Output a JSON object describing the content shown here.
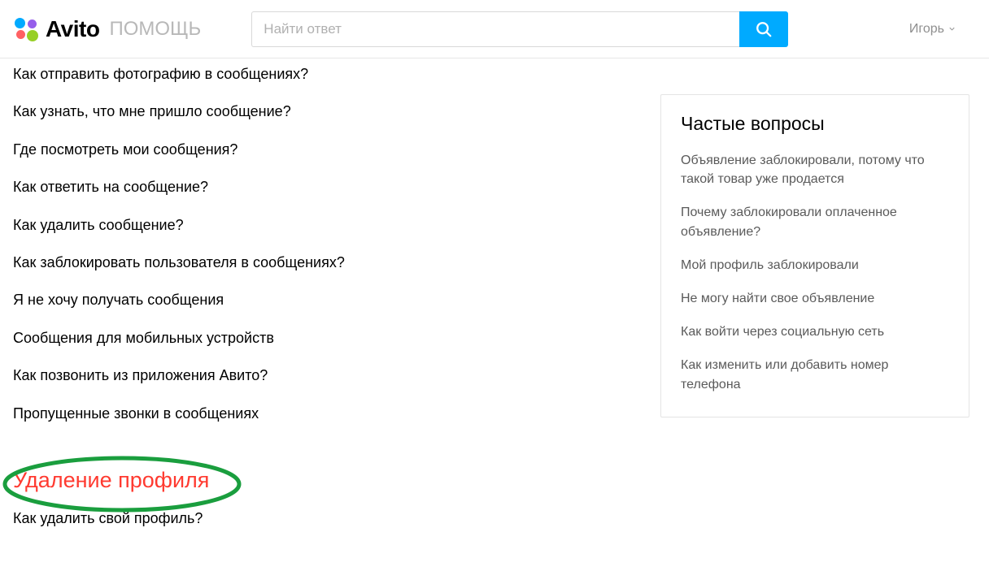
{
  "header": {
    "brand": "Avito",
    "brand_sub": "ПОМОЩЬ",
    "search_placeholder": "Найти ответ",
    "user_name": "Игорь"
  },
  "main": {
    "questions": [
      "Как отправить фотографию в сообщениях?",
      "Как узнать, что мне пришло сообщение?",
      "Где посмотреть мои сообщения?",
      "Как ответить на сообщение?",
      "Как удалить сообщение?",
      "Как заблокировать пользователя в сообщениях?",
      "Я не хочу получать сообщения",
      "Сообщения для мобильных устройств",
      "Как позвонить из приложения Авито?",
      "Пропущенные звонки в сообщениях"
    ],
    "highlighted_section": "Удаление профиля",
    "sub_question": "Как удалить свой профиль?"
  },
  "sidebar": {
    "title": "Частые вопросы",
    "faq": [
      "Объявление заблокировали, потому что такой товар уже продается",
      "Почему заблокировали оплаченное объявление?",
      "Мой профиль заблокировали",
      "Не могу найти свое объявление",
      "Как войти через социальную сеть",
      "Как изменить или добавить номер телефона"
    ]
  }
}
